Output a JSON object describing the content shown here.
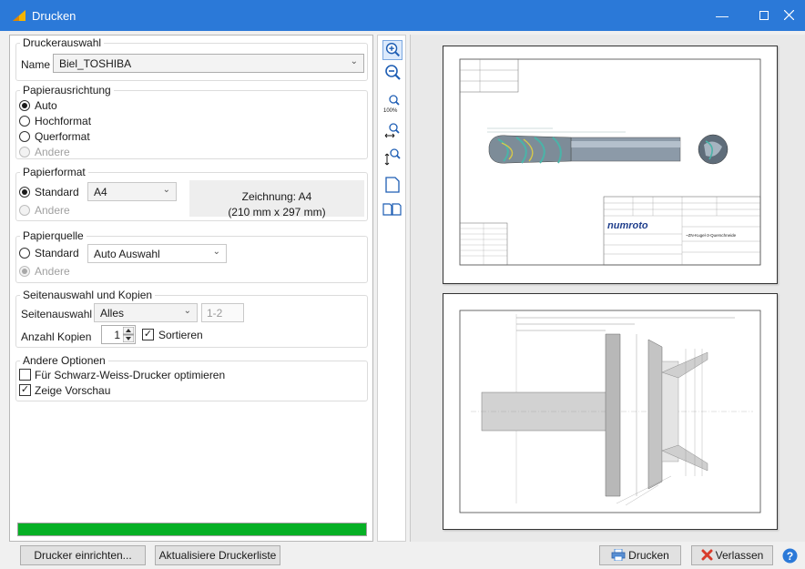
{
  "window": {
    "title": "Drucken"
  },
  "printer": {
    "group_title": "Druckerauswahl",
    "name_label": "Name",
    "selected": "Biel_TOSHIBA"
  },
  "orientation": {
    "group_title": "Papierausrichtung",
    "options": [
      "Auto",
      "Hochformat",
      "Querformat",
      "Andere"
    ],
    "selected": "Auto"
  },
  "paper_format": {
    "group_title": "Papierformat",
    "standard_label": "Standard",
    "standard_value": "A4",
    "other_label": "Andere",
    "drawing_line1": "Zeichnung: A4",
    "drawing_line2": "(210 mm x 297 mm)"
  },
  "paper_source": {
    "group_title": "Papierquelle",
    "standard_label": "Standard",
    "standard_value": "Auto Auswahl",
    "other_label": "Andere"
  },
  "pages": {
    "group_title": "Seitenauswahl und Kopien",
    "selection_label": "Seitenauswahl",
    "selection_value": "Alles",
    "range_value": "1-2",
    "copies_label": "Anzahl Kopien",
    "copies_value": "1",
    "sort_label": "Sortieren",
    "sort_checked": true
  },
  "other_options": {
    "group_title": "Andere Optionen",
    "bw_label": "Für Schwarz-Weiss-Drucker optimieren",
    "bw_checked": false,
    "preview_label": "Zeige Vorschau",
    "preview_checked": true
  },
  "progress": {
    "value_percent": 100,
    "color": "#06b025"
  },
  "toolbar": {
    "icons": [
      "zoom-in-icon",
      "zoom-out-icon",
      "zoom-100-icon",
      "fit-width-icon",
      "fit-height-icon",
      "single-page-icon",
      "two-pages-icon"
    ],
    "zoom_100_text": "100%"
  },
  "preview": {
    "page1": {
      "company_logo": "numroto",
      "drawing_title": "~ZN-Kugel-3-Querschneide"
    }
  },
  "buttons": {
    "setup": "Drucker einrichten...",
    "refresh": "Aktualisiere Druckerliste",
    "print": "Drucken",
    "exit": "Verlassen"
  },
  "colors": {
    "titlebar": "#2b79d8",
    "accent": "#2b79d8",
    "exit_icon": "#d83b2b"
  }
}
